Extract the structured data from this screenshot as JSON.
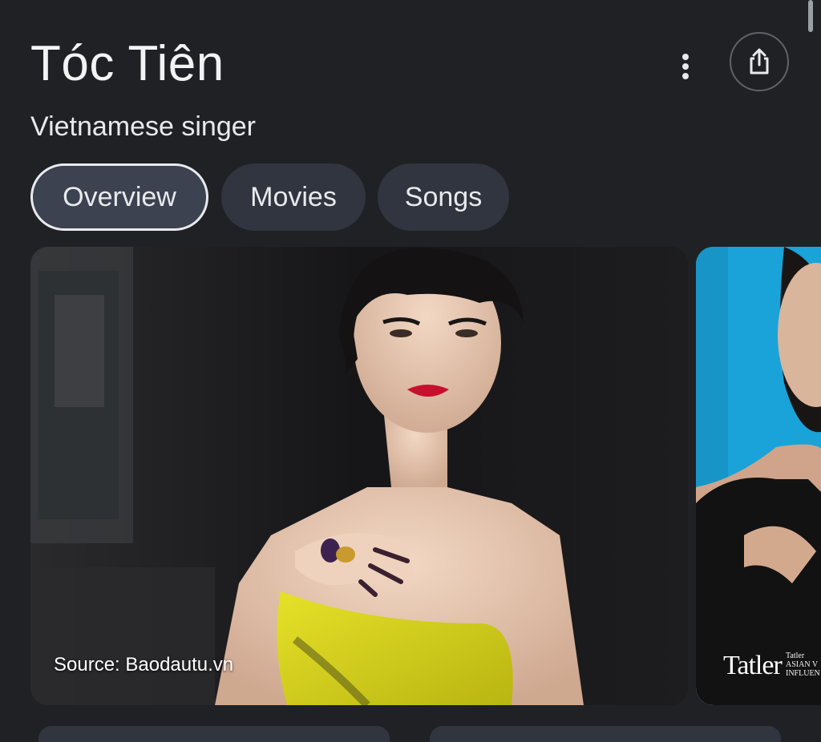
{
  "header": {
    "title": "Tóc Tiên",
    "subtitle": "Vietnamese singer",
    "more_icon": "more-vert-icon",
    "share_icon": "share-icon"
  },
  "tabs": [
    {
      "label": "Overview",
      "selected": true
    },
    {
      "label": "Movies",
      "selected": false
    },
    {
      "label": "Songs",
      "selected": false
    }
  ],
  "images": {
    "main": {
      "source": "Source: Baodautu.vn"
    },
    "side": {
      "logo_text": "Tatler",
      "caption_line1": "Tatler",
      "caption_line2": "ASIAN V",
      "caption_line3": "INFLUEN"
    }
  },
  "colors": {
    "background": "#202124",
    "chip": "#303540",
    "chip_selected_border": "#e8eaed",
    "dress": "#d7d21c",
    "lips": "#c8102e",
    "side_background": "#1aa3d8"
  }
}
